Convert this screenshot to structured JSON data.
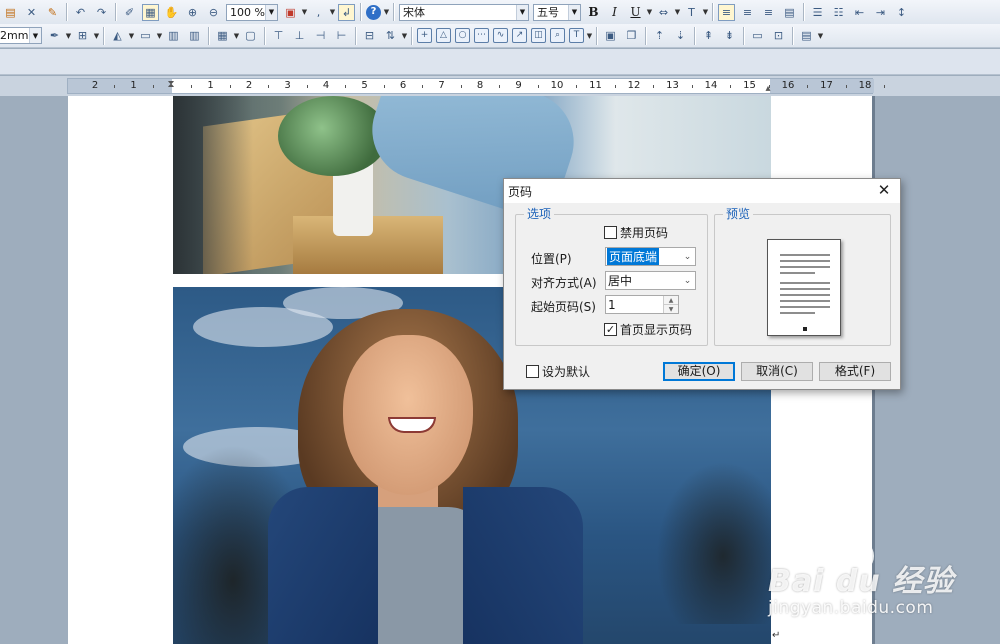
{
  "toolbar1": {
    "zoom": "100 %",
    "font_name": "宋体",
    "font_size": "五号",
    "bold_label": "B",
    "italic_label": "I",
    "underline_label": "U",
    "help_label": "?"
  },
  "toolbar2": {
    "line_width": "2mm"
  },
  "ruler": {
    "labels": [
      "2",
      "1",
      "1",
      "2",
      "3",
      "4",
      "5",
      "6",
      "7",
      "8",
      "9",
      "10",
      "11",
      "12",
      "13",
      "14",
      "15",
      "16",
      "17",
      "18"
    ]
  },
  "dialog": {
    "title": "页码",
    "options_legend": "选项",
    "preview_legend": "预览",
    "disable_page_number": {
      "label": "禁用页码",
      "checked": false
    },
    "position": {
      "label": "位置(P)",
      "value": "页面底端"
    },
    "alignment": {
      "label": "对齐方式(A)",
      "value": "居中"
    },
    "start_page": {
      "label": "起始页码(S)",
      "value": "1"
    },
    "show_on_first_page": {
      "label": "首页显示页码",
      "checked": true
    },
    "set_default": {
      "label": "设为默认",
      "checked": false
    },
    "buttons": {
      "ok": "确定(O)",
      "cancel": "取消(C)",
      "format": "格式(F)"
    },
    "check_glyph": "✓"
  },
  "watermark": {
    "logo_text": "Bai  du 经验",
    "url": "jingyan.baidu.com"
  },
  "colors": {
    "legend_blue": "#1c62b9",
    "selection_blue": "#0078d7",
    "workspace": "#9eadbd"
  }
}
